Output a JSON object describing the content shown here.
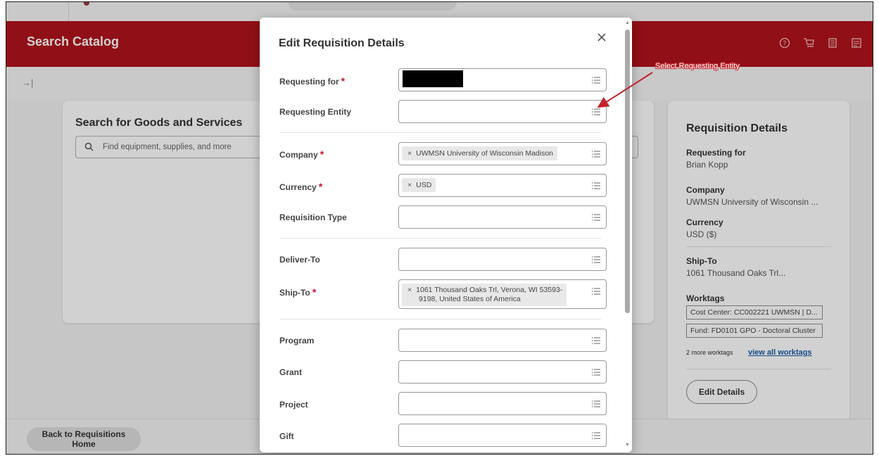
{
  "header": {
    "title": "Search Catalog",
    "icons": [
      "help-icon",
      "cart-icon",
      "document-icon",
      "pdf-icon"
    ]
  },
  "subbar": {
    "toggle": "→|"
  },
  "search": {
    "heading": "Search for Goods and Services",
    "placeholder": "Find equipment, supplies, and more"
  },
  "requisition_details": {
    "title": "Requisition Details",
    "requesting_for_label": "Requesting for",
    "requesting_for_value": "Brian Kopp",
    "company_label": "Company",
    "company_value": "UWMSN University of Wisconsin ...",
    "currency_label": "Currency",
    "currency_value": "USD ($)",
    "ship_to_label": "Ship-To",
    "ship_to_value": "1061 Thousand Oaks Trl...",
    "worktags_label": "Worktags",
    "worktags": [
      "Cost Center: CC002221 UWMSN | D...",
      "Fund: FD0101 GPO - Doctoral Cluster"
    ],
    "more_worktags": "2 more worktags",
    "view_all": "view all worktags",
    "edit_button": "Edit Details"
  },
  "footer": {
    "back_button": "Back to Requisitions Home"
  },
  "modal": {
    "title": "Edit Requisition Details",
    "required_marker": "*",
    "fields": {
      "requesting_for": {
        "label": "Requesting for"
      },
      "requesting_entity": {
        "label": "Requesting Entity"
      },
      "company": {
        "label": "Company",
        "value": "UWMSN University of Wisconsin Madison"
      },
      "currency": {
        "label": "Currency",
        "value": "USD"
      },
      "requisition_type": {
        "label": "Requisition Type"
      },
      "deliver_to": {
        "label": "Deliver-To"
      },
      "ship_to": {
        "label": "Ship-To",
        "value_line1": "1061 Thousand Oaks Trl, Verona, WI 53593-",
        "value_line2": "9198, United States of America"
      },
      "program": {
        "label": "Program"
      },
      "grant": {
        "label": "Grant"
      },
      "project": {
        "label": "Project"
      },
      "gift": {
        "label": "Gift"
      }
    },
    "chip_remove": "×"
  },
  "annotation": {
    "text": "Select Requesting Entity"
  },
  "colors": {
    "header_red": "#b1131c",
    "required": "#c8102e",
    "link": "#1a5dab",
    "annotation": "#c4232b"
  }
}
